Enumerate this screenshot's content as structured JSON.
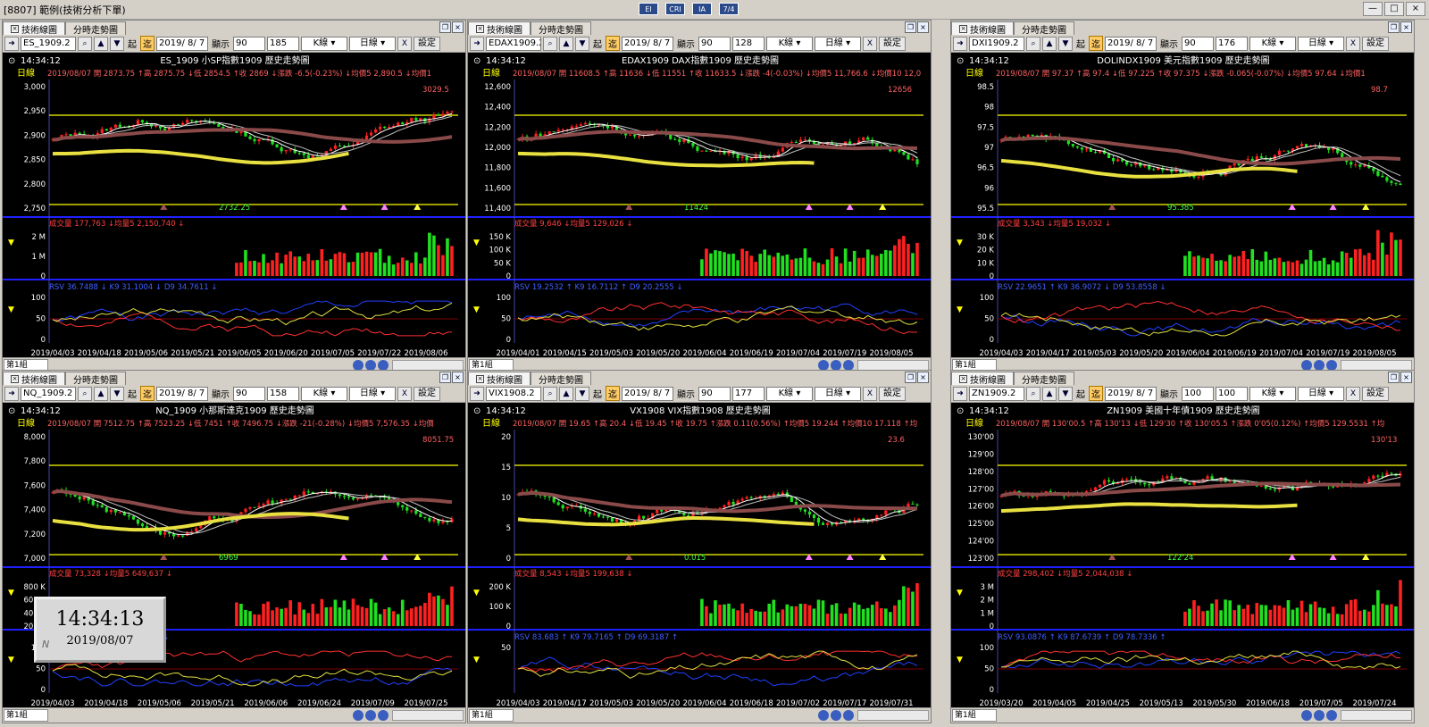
{
  "window": {
    "title": "[8807] 範例(技術分析下單)",
    "mid_buttons": [
      "EI",
      "CRI",
      "IA",
      "7/4"
    ],
    "controls": [
      "—",
      "□",
      "×"
    ]
  },
  "tabs": {
    "tech": "技術線圖",
    "time": "分時走勢圖"
  },
  "toolbar": {
    "jump": "起",
    "cmp": "迄",
    "show": "顯示",
    "kline": "K線 ▾",
    "period": "日線 ▾",
    "settings": "設定"
  },
  "clock_widget": {
    "time": "14:34:13",
    "date": "2019/08/07"
  },
  "panels": [
    {
      "symbol_field": "ES_1909.2",
      "date_field": "2019/ 8/ 7",
      "count_a": "90",
      "count_b": "185",
      "time": "14:34:12",
      "heading": "ES_1909 小SP指數1909  歷史走勢圖",
      "info_label": "日線",
      "info": "2019/08/07 開 2873.75 ↑高 2875.75 ↓低 2854.5 ↑收 2869 ↓漲跌 -6.5(-0.23%) ↓均價5 2,890.5 ↓均價1",
      "high_label": "3029.5",
      "low_label": "2732.25",
      "price_ticks": [
        "3,000",
        "2,950",
        "2,900",
        "2,850",
        "2,800",
        "2,750"
      ],
      "vol_info": "成交量 177,763 ↓均量5 2,150,740 ↓",
      "vol_ticks": [
        "2 M",
        "1 M",
        "0"
      ],
      "kd_info": "RSV 36.7488 ↓ K9 31.1004 ↓ D9 34.7611 ↓",
      "kd_ticks": [
        "100",
        "50",
        "0"
      ],
      "dates": [
        "2019/04/03",
        "2019/04/18",
        "2019/05/06",
        "2019/05/21",
        "2019/06/05",
        "2019/06/20",
        "2019/07/05",
        "2019/07/22",
        "2019/08/06"
      ],
      "group": "第1組"
    },
    {
      "symbol_field": "EDAX1909.2",
      "date_field": "2019/ 8/ 7",
      "count_a": "90",
      "count_b": "128",
      "time": "14:34:12",
      "heading": "EDAX1909 DAX指數1909  歷史走勢圖",
      "info_label": "日線",
      "info": "2019/08/07 開 11608.5 ↑高 11636 ↓低 11551 ↑收 11633.5 ↓漲跌 -4(-0.03%) ↓均價5 11,766.6 ↓均價10 12,0",
      "high_label": "12656",
      "low_label": "11424",
      "price_ticks": [
        "12,600",
        "12,400",
        "12,200",
        "12,000",
        "11,800",
        "11,600",
        "11,400"
      ],
      "vol_info": "成交量 9,646 ↓均量5 129,026 ↓",
      "vol_ticks": [
        "150 K",
        "100 K",
        "50 K",
        "0"
      ],
      "kd_info": "RSV 19.2532 ↑ K9 16.7112 ↑ D9 20.2555 ↓",
      "kd_ticks": [
        "100",
        "50",
        "0"
      ],
      "dates": [
        "2019/04/01",
        "2019/04/15",
        "2019/05/03",
        "2019/05/20",
        "2019/06/04",
        "2019/06/19",
        "2019/07/04",
        "2019/07/19",
        "2019/08/05"
      ],
      "group": "第1組"
    },
    {
      "symbol_field": "DXI1909.2",
      "date_field": "2019/ 8/ 7",
      "count_a": "90",
      "count_b": "176",
      "time": "14:34:12",
      "heading": "DOLINDX1909 美元指數1909  歷史走勢圖",
      "info_label": "日線",
      "info": "2019/08/07 開 97.37 ↑高 97.4 ↓低 97.225 ↑收 97.375 ↓漲跌 -0.065(-0.07%) ↓均價5 97.64 ↓均價1",
      "high_label": "98.7",
      "low_label": "95.385",
      "price_ticks": [
        "98.5",
        "98",
        "97.5",
        "97",
        "96.5",
        "96",
        "95.5"
      ],
      "vol_info": "成交量 3,343 ↓均量5 19,032 ↓",
      "vol_ticks": [
        "30 K",
        "20 K",
        "10 K",
        "0"
      ],
      "kd_info": "RSV 22.9651 ↑ K9 36.9072 ↓ D9 53.8558 ↓",
      "kd_ticks": [
        "100",
        "50",
        "0"
      ],
      "dates": [
        "2019/04/03",
        "2019/04/17",
        "2019/05/03",
        "2019/05/20",
        "2019/06/04",
        "2019/06/19",
        "2019/07/04",
        "2019/07/19",
        "2019/08/05"
      ],
      "group": "第1組"
    },
    {
      "symbol_field": "NQ_1909.2",
      "date_field": "2019/ 8/ 7",
      "count_a": "90",
      "count_b": "158",
      "time": "14:34:12",
      "heading": "NQ_1909 小那斯達克1909  歷史走勢圖",
      "info_label": "日線",
      "info": "2019/08/07 開 7512.75 ↑高 7523.25 ↓低 7451 ↑收 7496.75 ↓漲跌 -21(-0.28%) ↓均價5 7,576.35 ↓均價",
      "high_label": "8051.75",
      "low_label": "6969",
      "price_ticks": [
        "8,000",
        "7,800",
        "7,600",
        "7,400",
        "7,200",
        "7,000"
      ],
      "vol_info": "成交量 73,328 ↓均量5 649,637 ↓",
      "vol_ticks": [
        "800 K",
        "600 K",
        "400 K",
        "200 K"
      ],
      "kd_info": "RSV ... ↓ K9 ... ↓ D9 33.1811 ↓",
      "kd_ticks": [
        "100",
        "50",
        "0"
      ],
      "dates": [
        "2019/04/03",
        "2019/04/18",
        "2019/05/06",
        "2019/05/21",
        "2019/06/06",
        "2019/06/24",
        "2019/07/09",
        "2019/07/25"
      ],
      "group": "第1組"
    },
    {
      "symbol_field": "VIX1908.2",
      "date_field": "2019/ 8/ 7",
      "count_a": "90",
      "count_b": "177",
      "time": "14:34:12",
      "heading": "VX1908 VIX指數1908  歷史走勢圖",
      "info_label": "日線",
      "info": "2019/08/07 開 19.65 ↑高 20.4 ↓低 19.45 ↑收 19.75 ↑漲跌 0.11(0.56%) ↑均價5 19.244 ↑均價10 17.118 ↑均",
      "high_label": "23.6",
      "low_label": "0.015",
      "price_ticks": [
        "20",
        "15",
        "10",
        "5",
        "0"
      ],
      "vol_info": "成交量 8,543 ↓均量5 199,638 ↓",
      "vol_ticks": [
        "200 K",
        "100 K",
        "0"
      ],
      "kd_info": "RSV 83.683 ↑ K9 79.7165 ↑ D9 69.3187 ↑",
      "kd_ticks": [
        "50"
      ],
      "dates": [
        "2019/04/03",
        "2019/04/17",
        "2019/05/03",
        "2019/05/20",
        "2019/06/04",
        "2019/06/18",
        "2019/07/02",
        "2019/07/17",
        "2019/07/31"
      ],
      "group": "第1組"
    },
    {
      "symbol_field": "ZN1909.2",
      "date_field": "2019/ 8/ 7",
      "count_a": "100",
      "count_b": "100",
      "time": "14:34:12",
      "heading": "ZN1909 美國十年債1909  歷史走勢圖",
      "info_label": "日線",
      "info": "2019/08/07 開 130'00.5 ↑高 130'13 ↓低 129'30 ↑收 130'05.5 ↑漲跌 0'05(0.12%) ↑均價5 129.5531 ↑均",
      "high_label": "130'13",
      "low_label": "122'24",
      "price_ticks": [
        "130'00",
        "129'00",
        "128'00",
        "127'00",
        "126'00",
        "125'00",
        "124'00",
        "123'00"
      ],
      "vol_info": "成交量 298,402 ↓均量5 2,044,038 ↓",
      "vol_ticks": [
        "3 M",
        "2 M",
        "1 M",
        "0"
      ],
      "kd_info": "RSV 93.0876 ↑ K9 87.6739 ↑ D9 78.7336 ↑",
      "kd_ticks": [
        "100",
        "50",
        "0"
      ],
      "dates": [
        "2019/03/20",
        "2019/04/05",
        "2019/04/25",
        "2019/05/13",
        "2019/05/30",
        "2019/06/18",
        "2019/07/05",
        "2019/07/24"
      ],
      "group": "第1組"
    }
  ],
  "colors": {
    "up": "#ff2020",
    "down": "#20e020",
    "bg": "#000000",
    "axis": "#0000ff",
    "hline": "#ffff00",
    "ma_long": "#8a4a4a",
    "ma_yellow": "#e8e040"
  }
}
